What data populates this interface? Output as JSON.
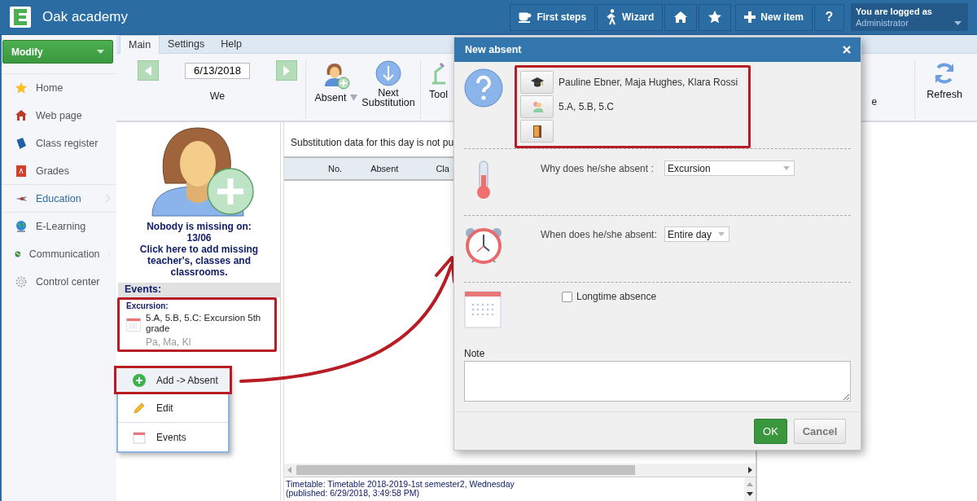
{
  "app": {
    "title": "Oak academy"
  },
  "header_buttons": [
    {
      "kind": "cup",
      "label": "First steps"
    },
    {
      "kind": "walker",
      "label": "Wizard"
    },
    {
      "kind": "home"
    },
    {
      "kind": "star"
    },
    {
      "kind": "plus",
      "label": "New item"
    },
    {
      "kind": "text",
      "label": "?"
    }
  ],
  "user": {
    "caption": "You are logged as",
    "name": "Administrator"
  },
  "sidebar": {
    "button": "Modify",
    "items": [
      {
        "kind": "star",
        "label": "Home",
        "selected": false,
        "submenu": false
      },
      {
        "kind": "house",
        "label": "Web page",
        "selected": false,
        "submenu": false
      },
      {
        "kind": "book",
        "label": "Class register",
        "selected": false,
        "submenu": false
      },
      {
        "kind": "grade",
        "label": "Grades",
        "selected": false,
        "submenu": false
      },
      {
        "kind": "plane",
        "label": "Education",
        "selected": true,
        "submenu": true
      },
      {
        "kind": "globe",
        "label": "E-Learning",
        "selected": false,
        "submenu": false
      },
      {
        "kind": "people",
        "label": "Communication",
        "selected": false,
        "submenu": true
      },
      {
        "kind": "gear",
        "label": "Control center",
        "selected": false,
        "submenu": false
      }
    ]
  },
  "ribbon": {
    "tabs": [
      {
        "label": "Main",
        "selected": true
      },
      {
        "label": "Settings",
        "selected": false
      },
      {
        "label": "Help",
        "selected": false
      }
    ],
    "date": "6/13/2018",
    "day": "We",
    "buttons": [
      {
        "kind": "absent",
        "label": "Absent"
      },
      {
        "kind": "next",
        "label": "Next Substitution"
      },
      {
        "kind": "tool",
        "label": "Tool"
      }
    ],
    "cut_label": "e",
    "refresh": "Refresh"
  },
  "absence_panel": {
    "message": "Nobody is missing on:\n13/06\nClick here to add missing teacher's, classes and classrooms."
  },
  "events": {
    "heading": "Events:",
    "items": [
      {
        "type": "Excursion:",
        "title": "5.A, 5.B, 5.C: Excursion 5th grade",
        "people": "Pa, Ma, Kl"
      }
    ]
  },
  "context_menu": [
    {
      "kind": "add",
      "label": "Add -> Absent",
      "selected": true
    },
    {
      "kind": "edit",
      "label": "Edit",
      "selected": false
    },
    {
      "kind": "events",
      "label": "Events",
      "selected": false
    }
  ],
  "substitutions": {
    "notice": "Substitution data for this day is not pu",
    "columns": [
      "No.",
      "Absent",
      "Cla"
    ],
    "footer": "Timetable: Timetable 2018-2019-1st semester2, Wednesday\n(published: 6/29/2018, 3:49:58 PM)"
  },
  "dialog": {
    "title": "New absent",
    "subjects": [
      {
        "kind": "teacher",
        "text": "Pauline Ebner, Maja Hughes, Klara Rossi"
      },
      {
        "kind": "class",
        "text": "5.A, 5.B, 5.C"
      },
      {
        "kind": "room"
      }
    ],
    "reason": {
      "label": "Why does he/she absent :",
      "value": "Excursion"
    },
    "time": {
      "label": "When does he/she absent:",
      "value": "Entire day"
    },
    "longtime": {
      "label": "Longtime absence",
      "checked": false
    },
    "note": {
      "label": "Note"
    },
    "buttons": [
      {
        "kind": "primary",
        "label": "OK"
      },
      {
        "kind": "secondary",
        "label": "Cancel"
      }
    ]
  }
}
